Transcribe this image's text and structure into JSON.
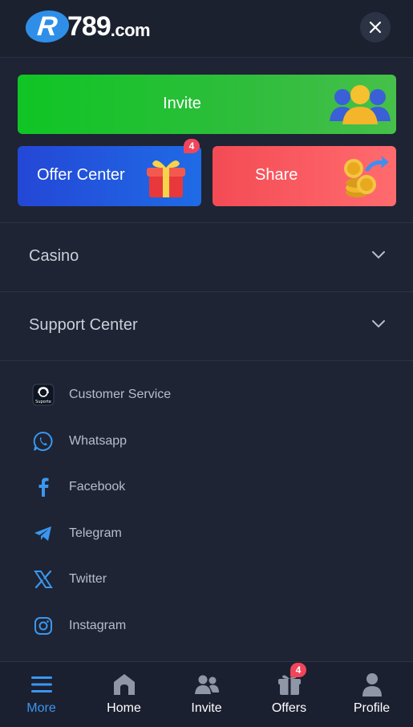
{
  "header": {
    "logo_r": "R",
    "logo_digits": "789",
    "logo_suffix": ".com"
  },
  "promo": {
    "invite_label": "Invite",
    "offer_label": "Offer Center",
    "offer_badge": "4",
    "share_label": "Share"
  },
  "menu": {
    "casino_label": "Casino",
    "support_label": "Support Center"
  },
  "support_icon_text": "Suporte",
  "social": [
    {
      "label": "Customer Service",
      "icon": "headset-icon"
    },
    {
      "label": "Whatsapp",
      "icon": "whatsapp-icon"
    },
    {
      "label": "Facebook",
      "icon": "facebook-icon"
    },
    {
      "label": "Telegram",
      "icon": "telegram-icon"
    },
    {
      "label": "Twitter",
      "icon": "x-twitter-icon"
    },
    {
      "label": "Instagram",
      "icon": "instagram-icon"
    }
  ],
  "tabs": [
    {
      "label": "More",
      "active": true
    },
    {
      "label": "Home"
    },
    {
      "label": "Invite"
    },
    {
      "label": "Offers",
      "badge": "4"
    },
    {
      "label": "Profile"
    }
  ],
  "colors": {
    "background": "#1e2433",
    "accent_blue": "#3a97f0",
    "invite_green": "#1fc232",
    "share_red": "#ff5f63",
    "offer_blue": "#1f5fe0",
    "badge_red": "#f0455a"
  }
}
